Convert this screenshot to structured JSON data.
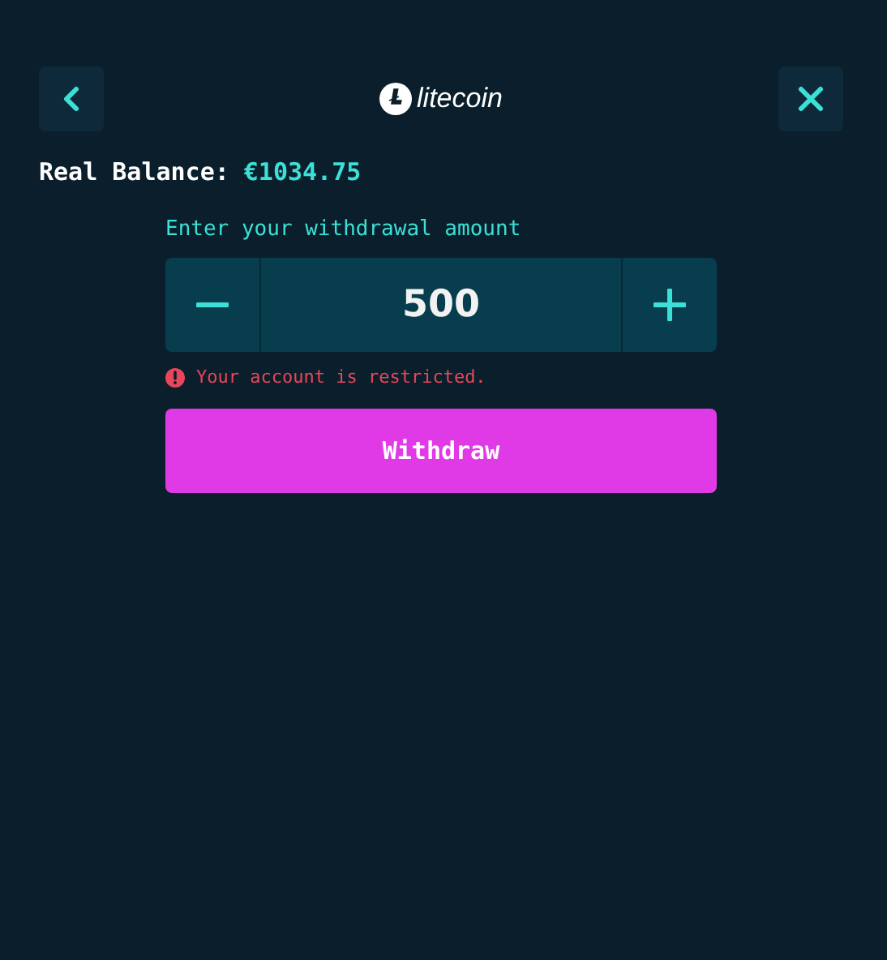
{
  "header": {
    "logo_text": "litecoin"
  },
  "balance": {
    "label": "Real Balance:",
    "amount": "€1034.75"
  },
  "withdrawal": {
    "label": "Enter your withdrawal amount",
    "value": "500",
    "error": "Your account is restricted.",
    "button": "Withdraw"
  }
}
